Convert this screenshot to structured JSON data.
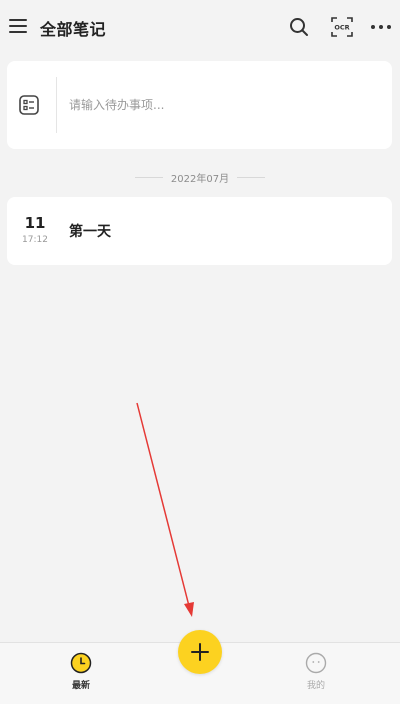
{
  "header": {
    "title": "全部笔记",
    "icons": [
      "menu-icon",
      "search-icon",
      "ocr-scan-icon",
      "more-icon"
    ],
    "ocr_label": "OCR"
  },
  "todo": {
    "placeholder": "请输入待办事项...",
    "icon": "checklist-icon"
  },
  "month_label": "2022年07月",
  "notes": [
    {
      "day": "11",
      "time": "17:12",
      "title": "第一天"
    }
  ],
  "bottom_nav": {
    "latest_label": "最新",
    "latest_icon": "clock-icon",
    "mine_label": "我的",
    "mine_icon": "profile-face-icon",
    "add_icon": "plus-icon"
  },
  "colors": {
    "accent": "#fcd220",
    "background": "#f3f3f3",
    "annotation_arrow": "#e53935"
  }
}
